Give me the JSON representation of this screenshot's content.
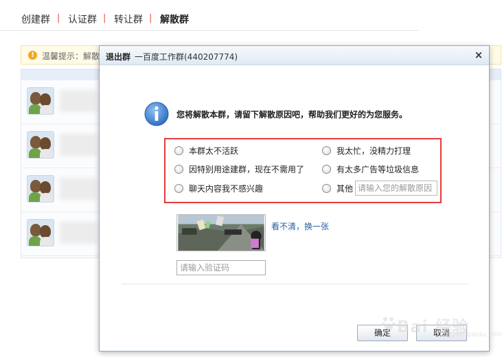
{
  "topnav": {
    "tabs": [
      {
        "label": "创建群",
        "active": false
      },
      {
        "label": "认证群",
        "active": false
      },
      {
        "label": "转让群",
        "active": false
      },
      {
        "label": "解散群",
        "active": true
      }
    ],
    "separator": "|"
  },
  "background": {
    "tip_text": "温馨提示：解散",
    "tip_icon": "exclamation-icon"
  },
  "dialog": {
    "title_main": "退出群",
    "title_sub": "一百度工作群(440207774)",
    "close_label": "×",
    "message": "您将解散本群，请留下解散原因吧，帮助我们更好的为您服务。",
    "reasons": [
      {
        "label": "本群太不活跃",
        "selected": false
      },
      {
        "label": "我太忙，没精力打理",
        "selected": false
      },
      {
        "label": "因特别用途建群，现在不需用了",
        "selected": false
      },
      {
        "label": "有太多广告等垃圾信息",
        "selected": false
      },
      {
        "label": "聊天内容我不感兴趣",
        "selected": false
      },
      {
        "label": "其他",
        "selected": false
      }
    ],
    "other_placeholder": "请输入您的解散原因",
    "refresh_link": "看不清，换一张",
    "code_placeholder": "请输入验证码",
    "ok_label": "确定",
    "cancel_label": "取消"
  },
  "watermark": {
    "text": "Bai 经验",
    "sub": "jingyan.baidu.com"
  },
  "colors": {
    "highlight_border": "#e53a3a",
    "link": "#2462a6",
    "titlebar": "#dfe9f4",
    "info_icon": "#3f7fd0"
  }
}
